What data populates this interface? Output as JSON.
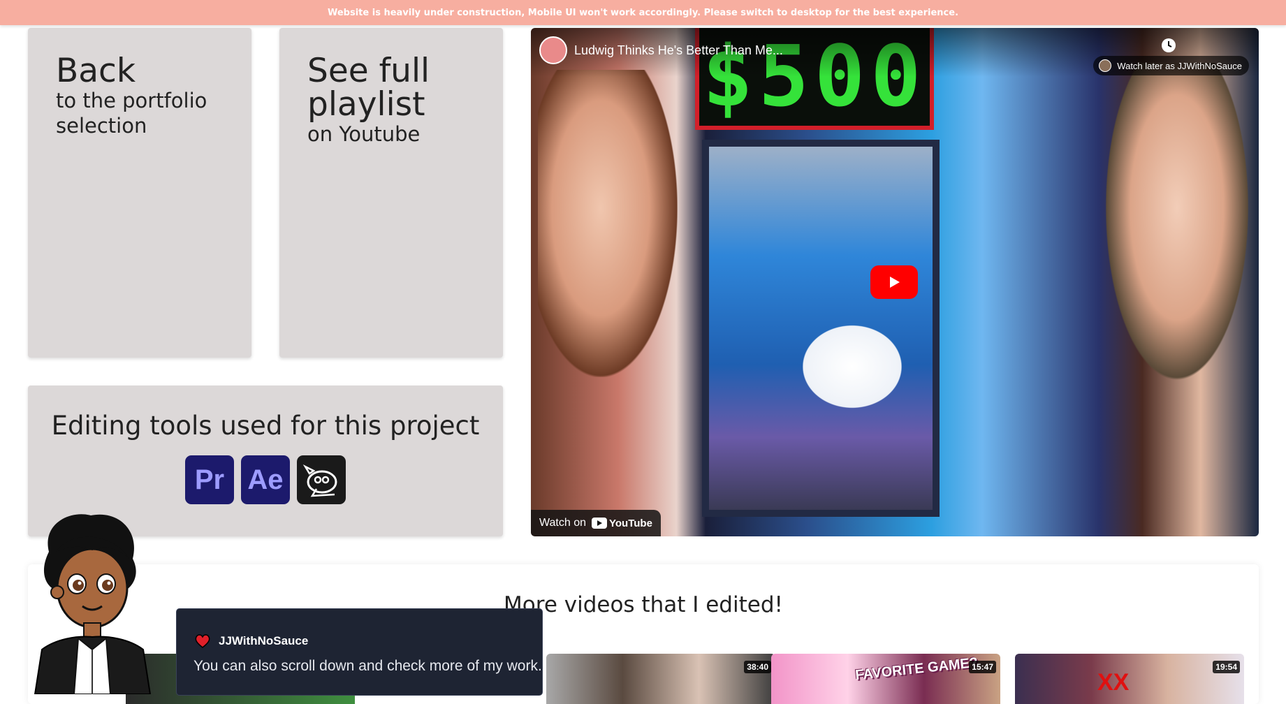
{
  "banner": {
    "text": "Website is heavily under construction, Mobile UI won't work accordingly. Please switch to desktop for the best experience."
  },
  "cards": {
    "back": {
      "title": "Back",
      "subtitle": "to the portfolio selection"
    },
    "playlist": {
      "title": "See full playlist",
      "subtitle": "on Youtube"
    }
  },
  "tools": {
    "title": "Editing tools used for this project",
    "items": [
      {
        "label": "Pr",
        "icon": "premiere-pro-icon"
      },
      {
        "label": "Ae",
        "icon": "after-effects-icon"
      },
      {
        "label": "",
        "icon": "gimp-icon"
      }
    ]
  },
  "video": {
    "title": "Ludwig Thinks He's Better Than Me...",
    "sign_text": "$500",
    "watch_later": "Watch later as JJWithNoSauce",
    "watch_on": "Watch on",
    "youtube_logo": "YouTube"
  },
  "more": {
    "title": "More videos that I edited!",
    "thumbnails": [
      {
        "duration": "",
        "overlay": ""
      },
      {
        "duration": "38:40",
        "overlay": ""
      },
      {
        "duration": "15:47",
        "overlay": "FAVORITE GAME?"
      },
      {
        "duration": "19:54",
        "overlay": "XX"
      }
    ]
  },
  "toast": {
    "name": "JJWithNoSauce",
    "message": "You can also scroll down and check more of my work.",
    "icon": "heart-icon"
  },
  "colors": {
    "banner_bg": "#f7aea0",
    "card_bg": "#dcd8d8",
    "toast_bg": "#1e2433",
    "youtube_red": "#ff0000"
  }
}
